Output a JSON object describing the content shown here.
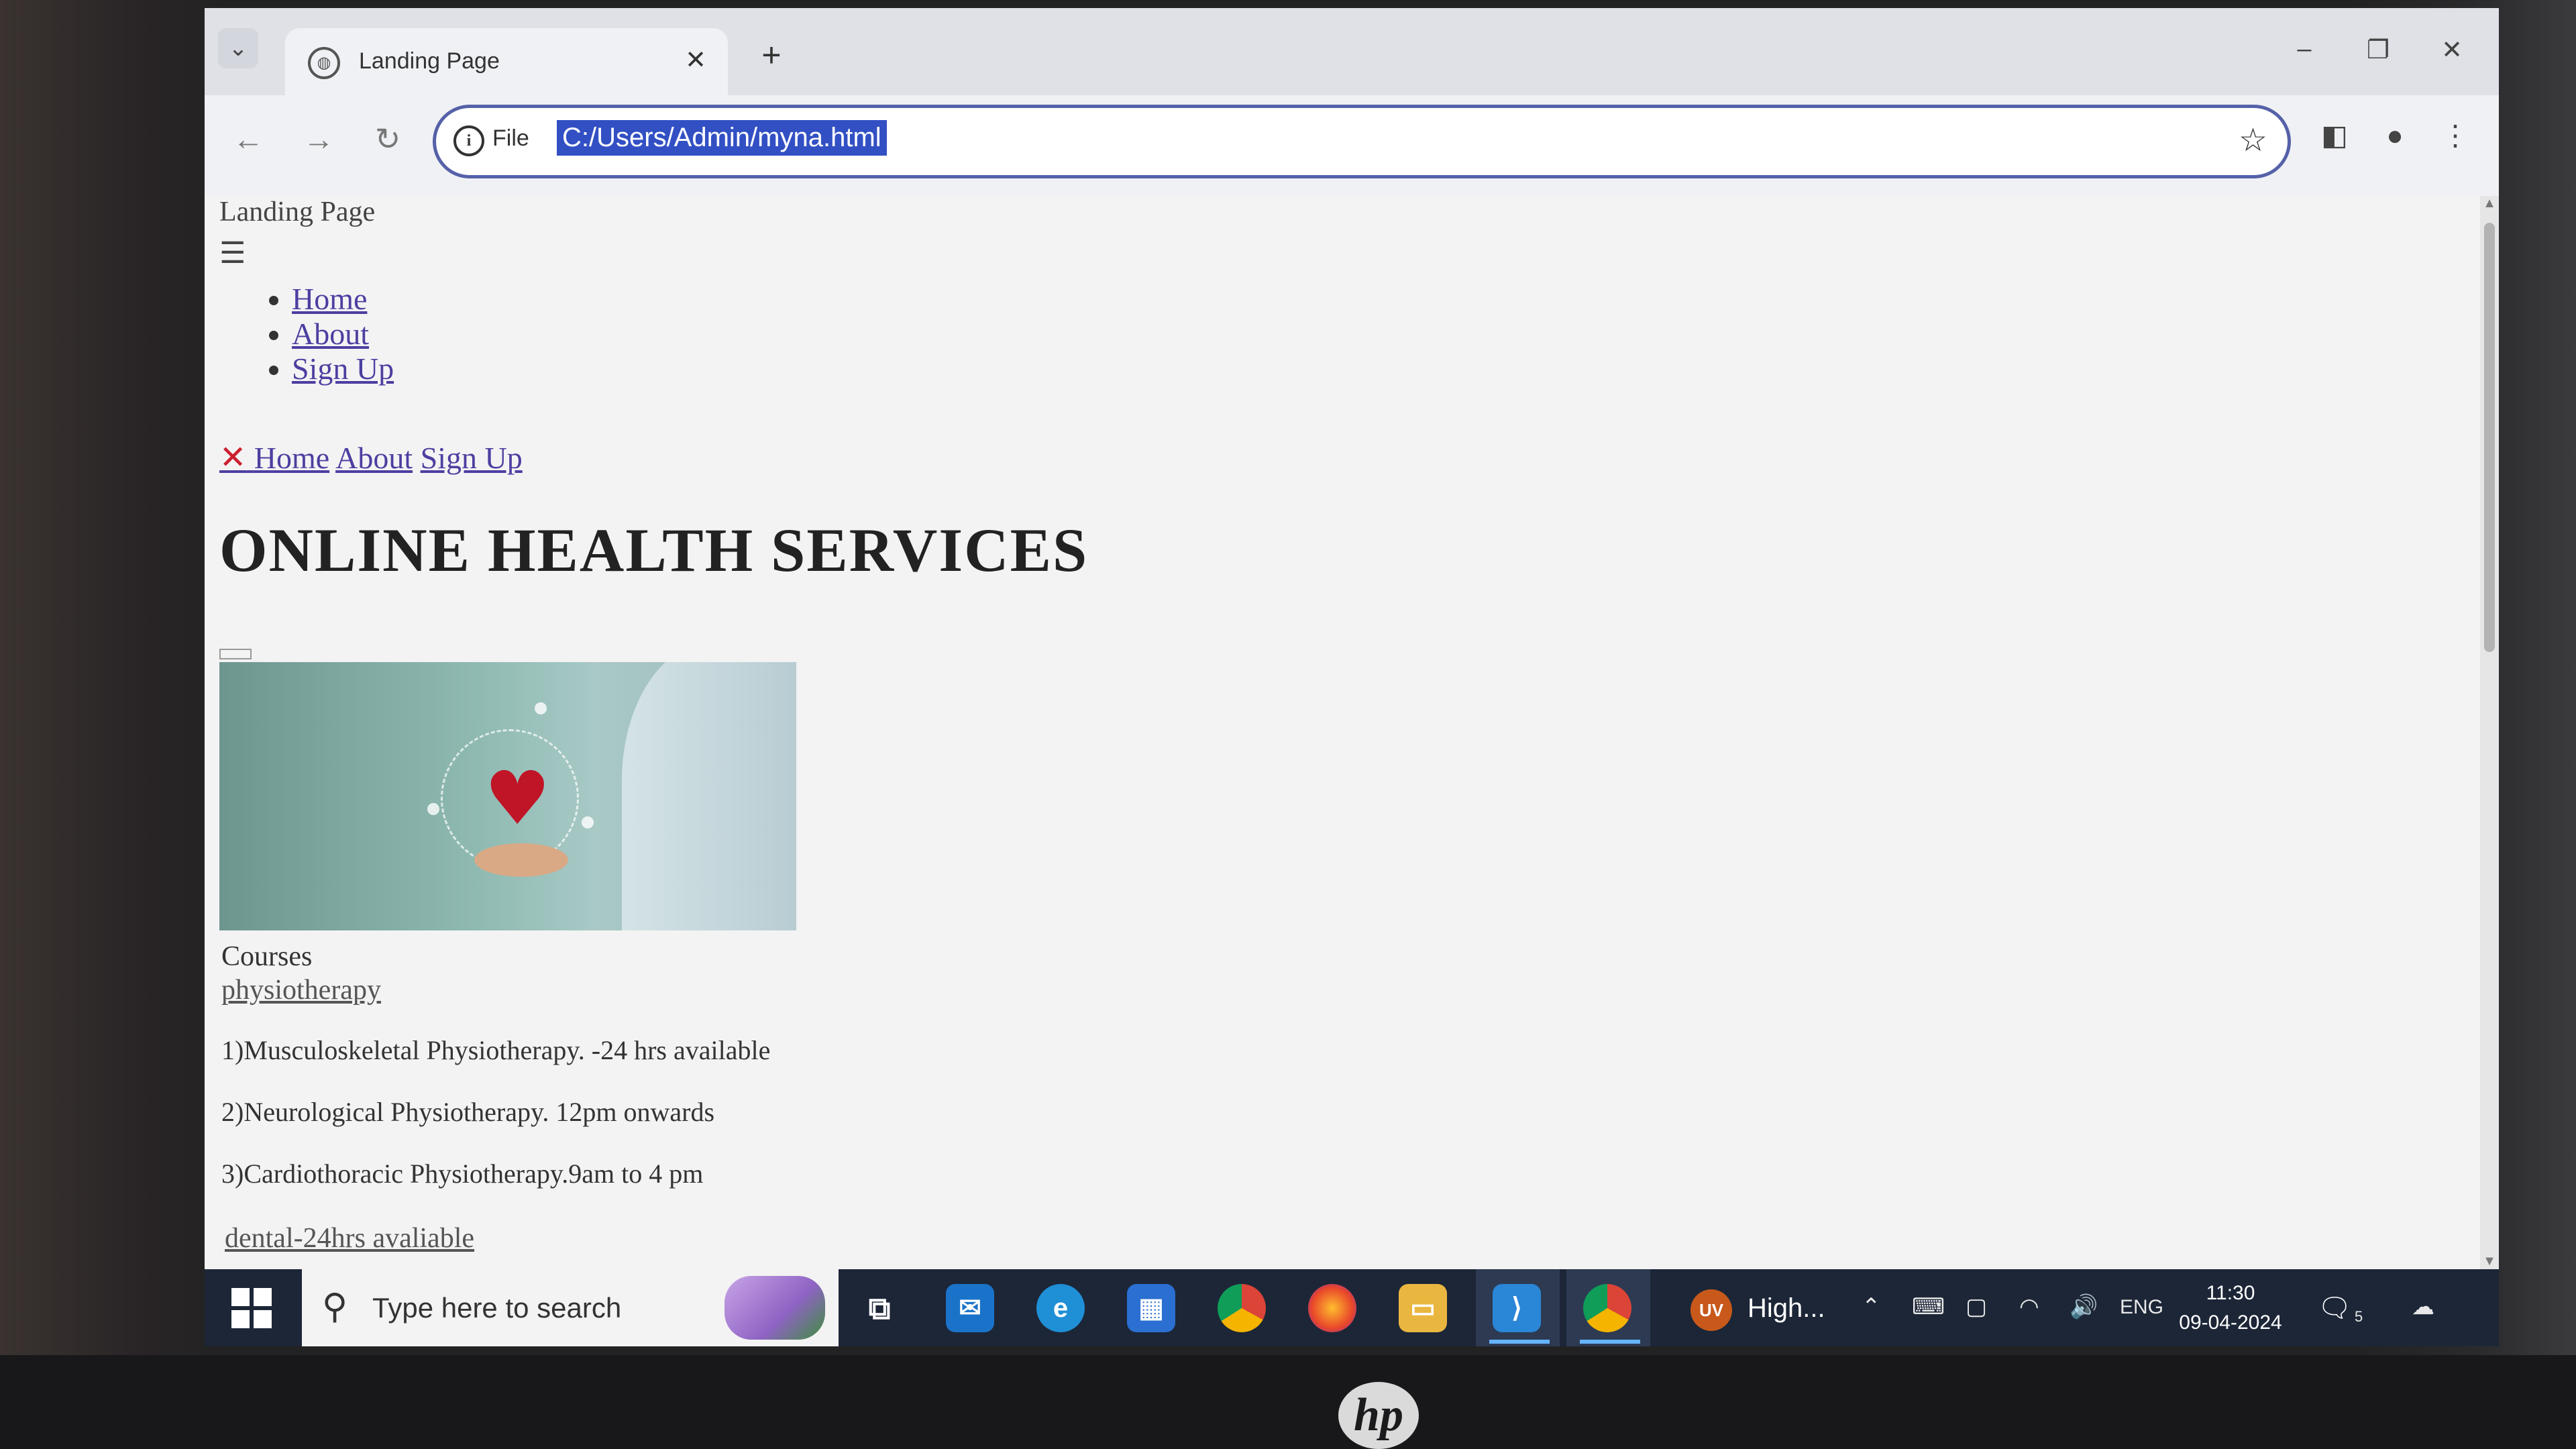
{
  "browser": {
    "tab_title": "Landing Page",
    "scheme_label": "File",
    "url": "C:/Users/Admin/myna.html"
  },
  "page": {
    "brand": "Landing Page",
    "menu_icon": "☰",
    "menu_items": [
      "Home",
      "About",
      "Sign Up"
    ],
    "topnav": [
      "Home",
      "About",
      "Sign Up"
    ],
    "heading": "ONLINE HEALTH SERVICES",
    "courses_label": "Courses",
    "course_link": "physiotherapy",
    "items": [
      "1)Musculoskeletal Physiotherapy. -24 hrs available",
      "2)Neurological Physiotherapy. 12pm onwards",
      "3)Cardiothoracic Physiotherapy.9am to 4 pm"
    ],
    "dental_link": "dental-24hrs avaliable"
  },
  "taskbar": {
    "search_placeholder": "Type here to search",
    "user_initials": "UV",
    "user_label": "High...",
    "language": "ENG",
    "time": "11:30",
    "date": "09-04-2024",
    "notification_count": "5"
  },
  "colors": {
    "link": "#4c3fa0",
    "close_x": "#cc1f2e",
    "url_highlight": "#3250c4",
    "taskbar": "#1c2637"
  }
}
